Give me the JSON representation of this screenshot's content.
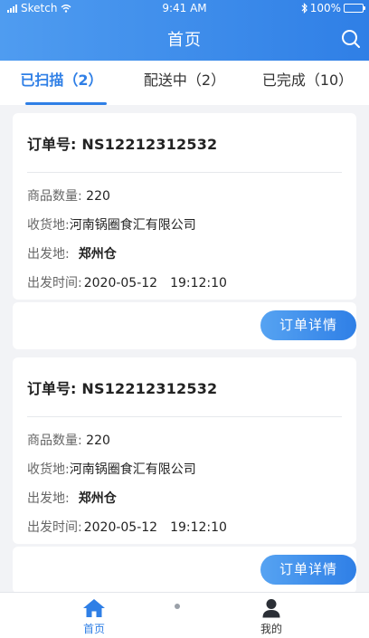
{
  "status_bar": {
    "carrier": "Sketch",
    "time": "9:41 AM",
    "battery": "100%"
  },
  "header": {
    "title": "首页"
  },
  "tabs": [
    {
      "label": "已扫描（2）",
      "active": true
    },
    {
      "label": "配送中（2）",
      "active": false
    },
    {
      "label": "已完成（10）",
      "active": false
    }
  ],
  "orders": [
    {
      "order_label": "订单号:",
      "order_no": "NS12212312532",
      "qty_label": "商品数量:",
      "qty": "220",
      "receiver_label": "收货地:",
      "receiver": "河南锅圈食汇有限公司",
      "origin_label": "出发地:",
      "origin": "郑州仓",
      "time_label": "出发时间:",
      "time": "2020-05-12　19:12:10",
      "button": "订单详情"
    },
    {
      "order_label": "订单号:",
      "order_no": "NS12212312532",
      "qty_label": "商品数量:",
      "qty": "220",
      "receiver_label": "收货地:",
      "receiver": "河南锅圈食汇有限公司",
      "origin_label": "出发地:",
      "origin": "郑州仓",
      "time_label": "出发时间:",
      "time": "2020-05-12　19:12:10",
      "button": "订单详情"
    }
  ],
  "tabbar": {
    "home": "首页",
    "mine": "我的"
  },
  "colors": {
    "accent": "#2f7fe6",
    "header_start": "#4f9cf0",
    "background": "#f2f3f6"
  },
  "icons": {
    "signal": "signal-icon",
    "wifi": "wifi-icon",
    "bluetooth": "bluetooth-icon",
    "battery": "battery-icon",
    "search": "search-icon",
    "home": "home-icon",
    "user": "user-icon"
  }
}
